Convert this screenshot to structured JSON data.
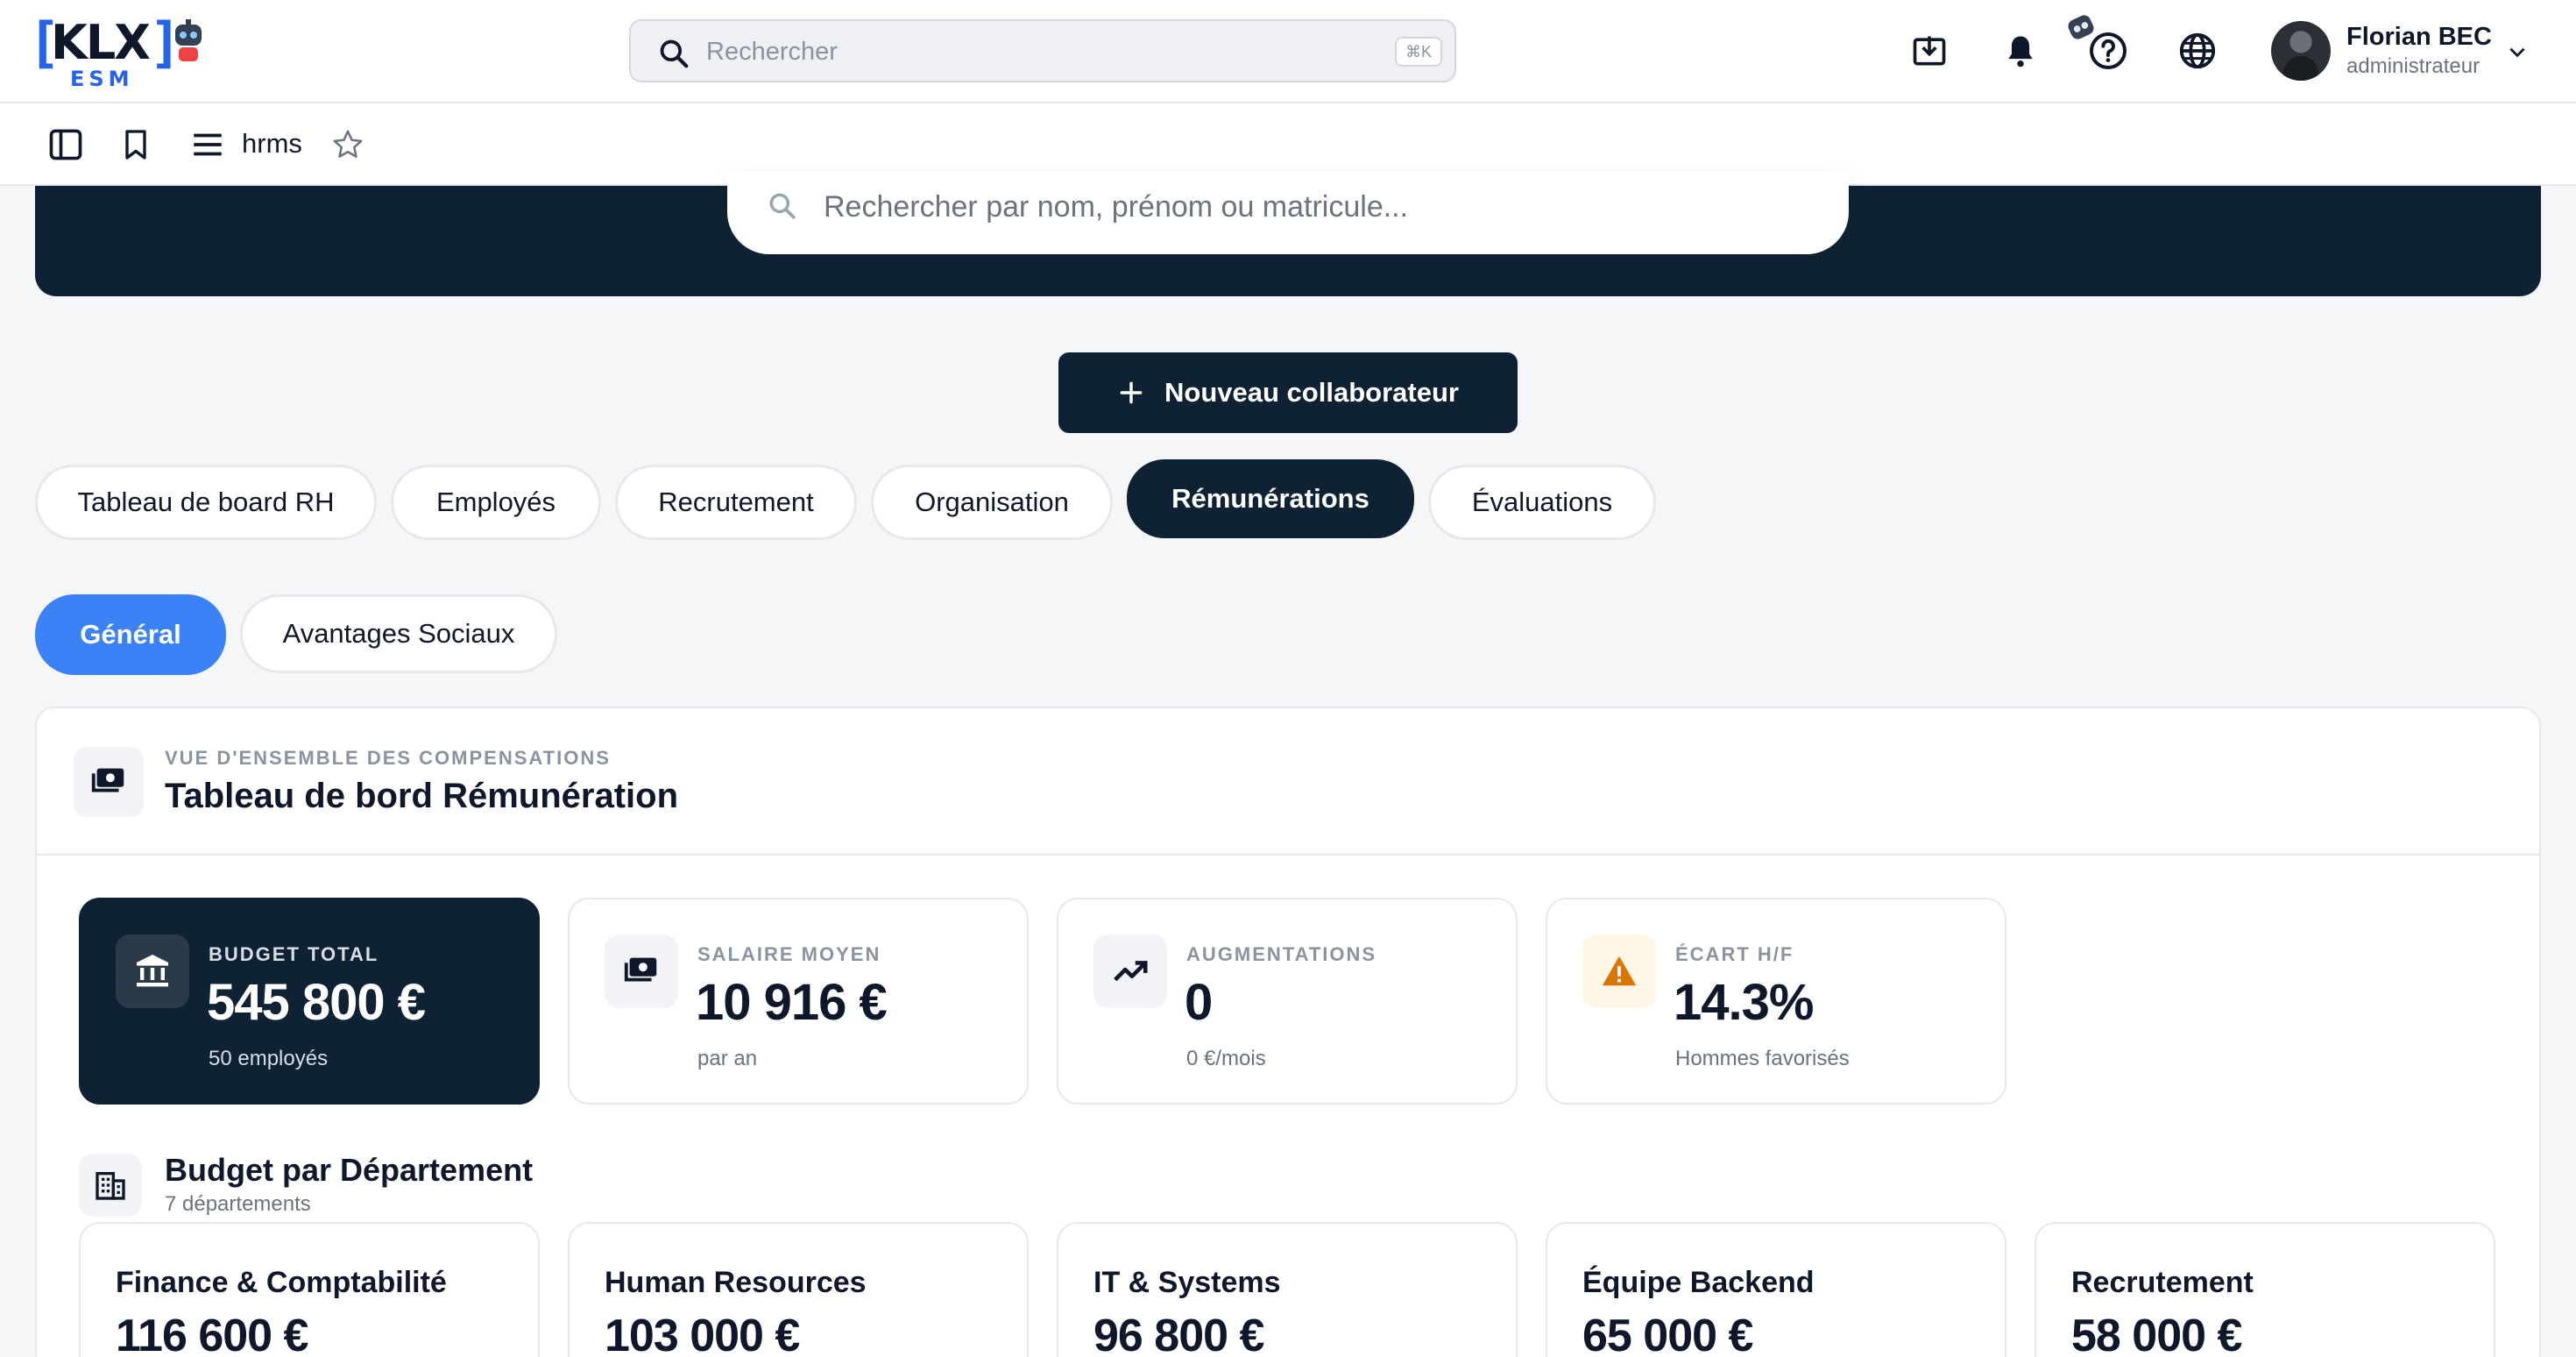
{
  "header": {
    "logo": {
      "text": "KLX",
      "sub": "ESM"
    },
    "search": {
      "placeholder": "Rechercher",
      "shortcut": "⌘K"
    },
    "icons": [
      "download-icon",
      "bell-icon",
      "robot-icon",
      "help-icon",
      "globe-icon",
      "chevron-down-icon"
    ],
    "user": {
      "name": "Florian BEC",
      "role": "administrateur"
    }
  },
  "subbar": {
    "icons": [
      "sidebar-icon",
      "bookmark-icon",
      "menu-icon",
      "star-icon"
    ],
    "module": "hrms"
  },
  "hero": {
    "search_placeholder": "Rechercher par nom, prénom ou matricule..."
  },
  "actions": {
    "new_collaborator": "Nouveau collaborateur"
  },
  "tabs": [
    {
      "label": "Tableau de board RH",
      "active": false
    },
    {
      "label": "Employés",
      "active": false
    },
    {
      "label": "Recrutement",
      "active": false
    },
    {
      "label": "Organisation",
      "active": false
    },
    {
      "label": "Rémunérations",
      "active": true
    },
    {
      "label": "Évaluations",
      "active": false
    }
  ],
  "subtabs": [
    {
      "label": "Général",
      "active": true
    },
    {
      "label": "Avantages Sociaux",
      "active": false
    }
  ],
  "panel": {
    "eyebrow": "VUE D'ENSEMBLE DES COMPENSATIONS",
    "title": "Tableau de bord Rémunération",
    "kpis": [
      {
        "label": "BUDGET TOTAL",
        "value": "545 800 €",
        "sub": "50 employés",
        "icon": "bank-icon"
      },
      {
        "label": "SALAIRE MOYEN",
        "value": "10 916 €",
        "sub": "par an",
        "icon": "money-icon"
      },
      {
        "label": "AUGMENTATIONS",
        "value": "0",
        "sub": "0 €/mois",
        "icon": "trending-up-icon"
      },
      {
        "label": "ÉCART H/F",
        "value": "14.3%",
        "sub": "Hommes favorisés",
        "icon": "warning-icon"
      }
    ],
    "departments": {
      "title": "Budget par Département",
      "subtitle": "7 départements",
      "items": [
        {
          "name": "Finance & Comptabilité",
          "value": "116 600 €"
        },
        {
          "name": "Human Resources",
          "value": "103 000 €"
        },
        {
          "name": "IT & Systems",
          "value": "96 800 €"
        },
        {
          "name": "Équipe Backend",
          "value": "65 000 €"
        },
        {
          "name": "Recrutement",
          "value": "58 000 €"
        }
      ]
    }
  },
  "colors": {
    "navy": "#0f2233",
    "accent_blue": "#3b82f6",
    "logo_blue": "#2563eb",
    "warning": "#d97706"
  }
}
